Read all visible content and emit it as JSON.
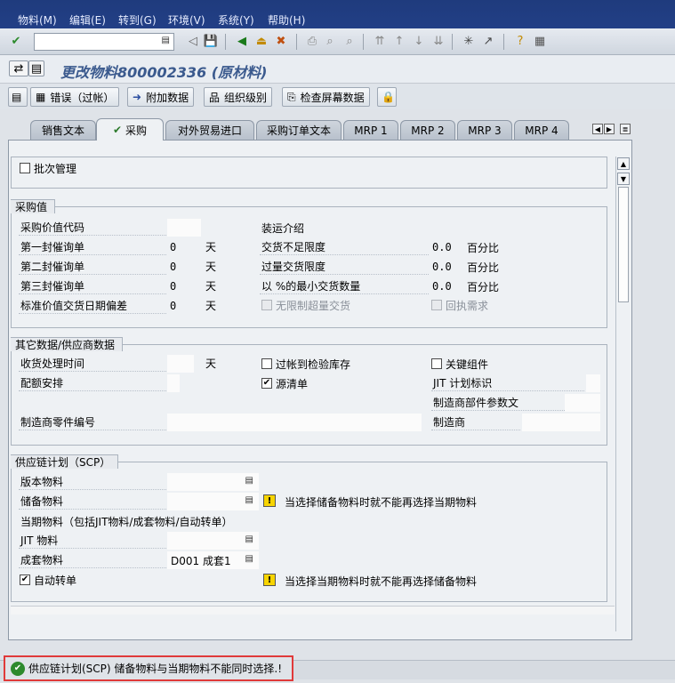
{
  "menu": [
    "物料(M)",
    "编辑(E)",
    "转到(G)",
    "环境(V)",
    "系统(Y)",
    "帮助(H)"
  ],
  "command_field": {
    "value": "",
    "placeholder": ""
  },
  "title": "更改物料800002336 (原材料)",
  "app_toolbar": {
    "errors": "错误（过帐）",
    "additional_data": "附加数据",
    "org_levels": "组织级别",
    "check_screen": "检查屏幕数据"
  },
  "tabs": [
    "销售文本",
    "采购",
    "对外贸易进口",
    "采购订单文本",
    "MRP 1",
    "MRP 2",
    "MRP 3",
    "MRP 4"
  ],
  "top": {
    "batch_management": "批次管理"
  },
  "purchasing_values": {
    "title": "采购值",
    "left": [
      {
        "label": "采购价值代码",
        "value": "",
        "unit": ""
      },
      {
        "label": "第一封催询单",
        "value": "0",
        "unit": "天"
      },
      {
        "label": "第二封催询单",
        "value": "0",
        "unit": "天"
      },
      {
        "label": "第三封催询单",
        "value": "0",
        "unit": "天"
      },
      {
        "label": "标准价值交货日期偏差",
        "value": "0",
        "unit": "天"
      }
    ],
    "right": [
      {
        "label": "装运介绍",
        "value": "",
        "unit": ""
      },
      {
        "label": "交货不足限度",
        "value": "0.0",
        "unit": "百分比"
      },
      {
        "label": "过量交货限度",
        "value": "0.0",
        "unit": "百分比"
      },
      {
        "label": "以 %的最小交货数量",
        "value": "0.0",
        "unit": "百分比"
      }
    ],
    "unlimited_overdelivery": "无限制超量交货",
    "ack_required": "回执需求"
  },
  "other_data": {
    "title": "其它数据/供应商数据",
    "gr_processing_time": "收货处理时间",
    "gr_unit": "天",
    "post_to_inspection": "过帐到检验库存",
    "critical_part": "关键组件",
    "quota_arrangement": "配额安排",
    "source_list": "源清单",
    "jit_indicator": "JIT 计划标识",
    "mfr_part_profile": "制造商部件参数文",
    "mfr_part_number": "制造商零件编号",
    "manufacturer": "制造商"
  },
  "scp": {
    "title": "供应链计划（SCP）",
    "version_material": "版本物料",
    "backup_material": "储备物料",
    "warning_1": "当选择储备物料时就不能再选择当期物料",
    "current_material_header": "当期物料（包括JIT物料/成套物料/自动转单）",
    "jit_material": "JIT 物料",
    "kit_material": "成套物料",
    "kit_material_value": "D001 成套1",
    "auto_transfer": "自动转单",
    "warning_2": "当选择当期物料时就不能再选择储备物料"
  },
  "status_message": "供应链计划(SCP) 储备物料与当期物料不能同时选择.!",
  "colors": {
    "menubar": "#1f3b7d",
    "title": "#3b5a8e",
    "status_border": "#e03a3a"
  }
}
